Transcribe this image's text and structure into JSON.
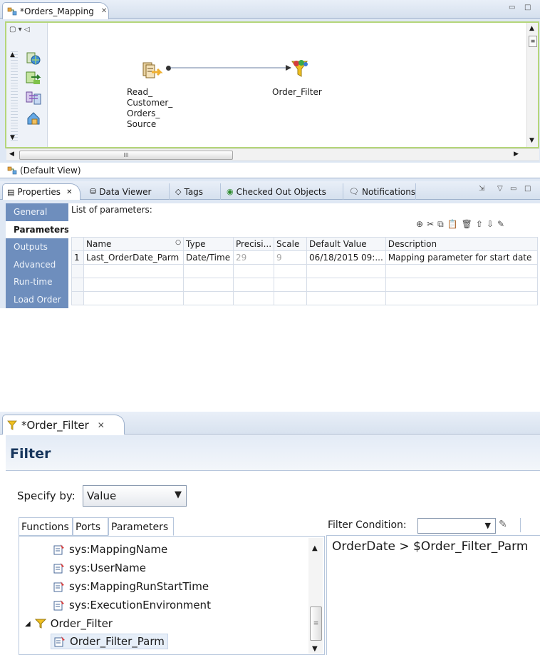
{
  "mapping_editor": {
    "tab_title": "*Orders_Mapping",
    "nodes": {
      "source": [
        "Read_",
        "Customer_",
        "Orders_",
        "Source"
      ],
      "filter": "Order_Filter"
    },
    "view_label": "(Default View)"
  },
  "views": {
    "tabs": [
      "Properties",
      "Data Viewer",
      "Tags",
      "Checked Out Objects",
      "Notifications"
    ]
  },
  "properties": {
    "side_items": [
      "General",
      "Parameters",
      "Outputs",
      "Advanced",
      "Run-time",
      "Load Order"
    ],
    "active_item": "Parameters",
    "list_label": "List of parameters:",
    "columns": [
      "Name",
      "Type",
      "Precisi...",
      "Scale",
      "Default Value",
      "Description"
    ],
    "rows": [
      {
        "index": "1",
        "name": "Last_OrderDate_Parm",
        "type": "Date/Time",
        "precision": "29",
        "scale": "9",
        "default_value": "06/18/2015 09:...",
        "description": "Mapping parameter for start date"
      }
    ]
  },
  "filter_editor": {
    "tab_title": "*Order_Filter",
    "section_title": "Filter",
    "specify_label": "Specify by:",
    "specify_value": "Value",
    "inner_tabs": [
      "Functions",
      "Ports",
      "Parameters"
    ],
    "tree_items": [
      "sys:MappingName",
      "sys:UserName",
      "sys:MappingRunStartTime",
      "sys:ExecutionEnvironment"
    ],
    "group_node": "Order_Filter",
    "selected_param": "Order_Filter_Parm",
    "condition_label": "Filter Condition:",
    "condition": "OrderDate > $Order_Filter_Parm"
  },
  "colors": {
    "side_panel": "#6e8ebd",
    "canvas_border": "#b5d67a",
    "header_text": "#17365d"
  }
}
